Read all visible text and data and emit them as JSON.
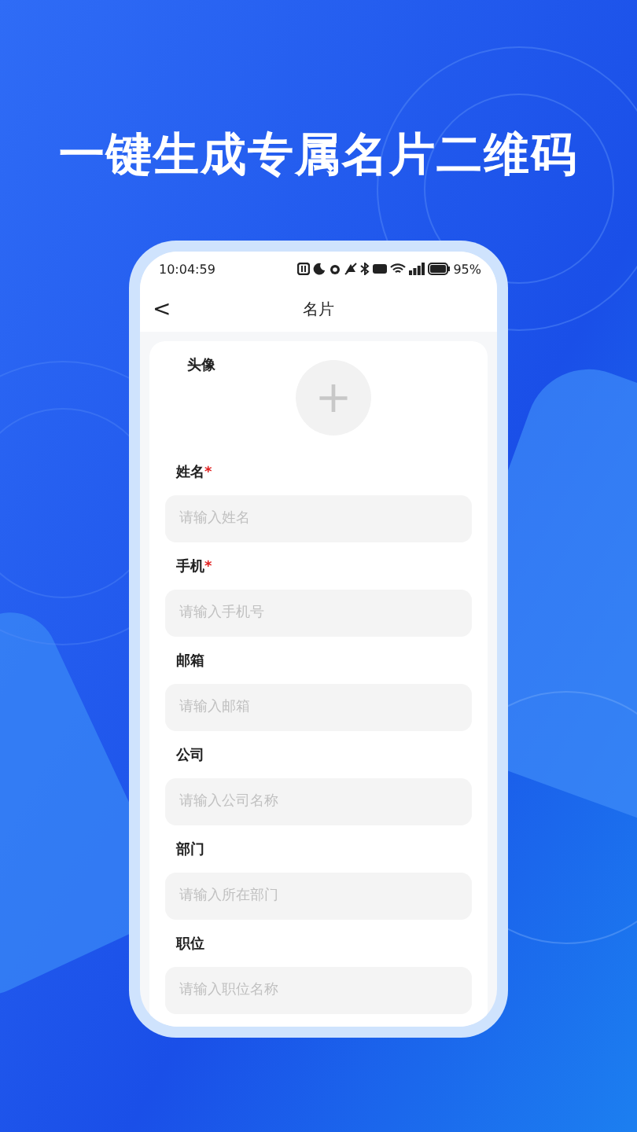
{
  "headline": "一键生成专属名片二维码",
  "status_bar": {
    "time": "10:04:59",
    "battery": "95%"
  },
  "nav": {
    "back": "<",
    "title": "名片"
  },
  "avatar": {
    "label": "头像",
    "add": "+"
  },
  "fields": [
    {
      "label": "姓名",
      "required_mark": "*",
      "placeholder": "请输入姓名"
    },
    {
      "label": "手机",
      "required_mark": "*",
      "placeholder": "请输入手机号"
    },
    {
      "label": "邮箱",
      "placeholder": "请输入邮箱"
    },
    {
      "label": "公司",
      "placeholder": "请输入公司名称"
    },
    {
      "label": "部门",
      "placeholder": "请输入所在部门"
    },
    {
      "label": "职位",
      "placeholder": "请输入职位名称"
    }
  ]
}
